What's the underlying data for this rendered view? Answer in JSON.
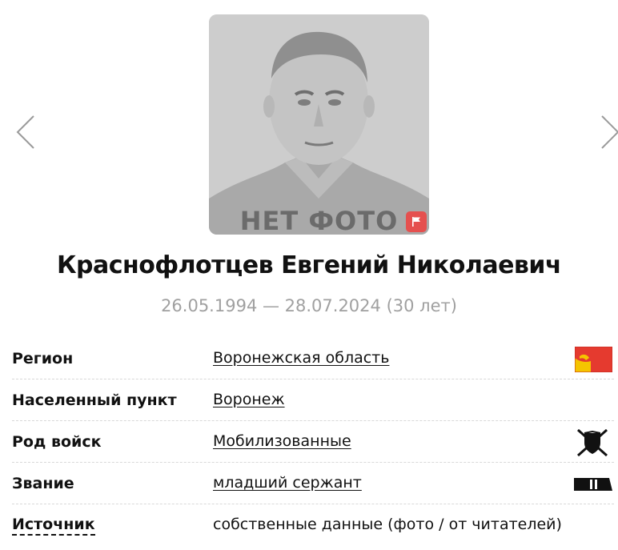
{
  "profile": {
    "no_photo_text": "НЕТ ФОТО",
    "name": "Краснофлотцев Евгений Николаевич",
    "dates": "26.05.1994 — 28.07.2024 (30 лет)"
  },
  "info": {
    "rows": [
      {
        "label": "Регион",
        "value": "Воронежская область",
        "icon": "region-flag-icon"
      },
      {
        "label": "Населенный пункт",
        "value": "Воронеж"
      },
      {
        "label": "Род войск",
        "value": "Мобилизованные",
        "icon": "shield-swords-icon"
      },
      {
        "label": "Звание",
        "value": "младший сержант",
        "icon": "rank-insignia-icon"
      },
      {
        "label": "Источник",
        "value": "собственные данные (фото / от читателей)"
      }
    ]
  },
  "colors": {
    "flag_button": "#e5504f",
    "dates_text": "#a0a0a0",
    "region_flag_red": "#e53a2f",
    "region_flag_yellow": "#f5c400"
  },
  "icons": [
    "chevron-left-icon",
    "chevron-right-icon",
    "flag-icon"
  ]
}
